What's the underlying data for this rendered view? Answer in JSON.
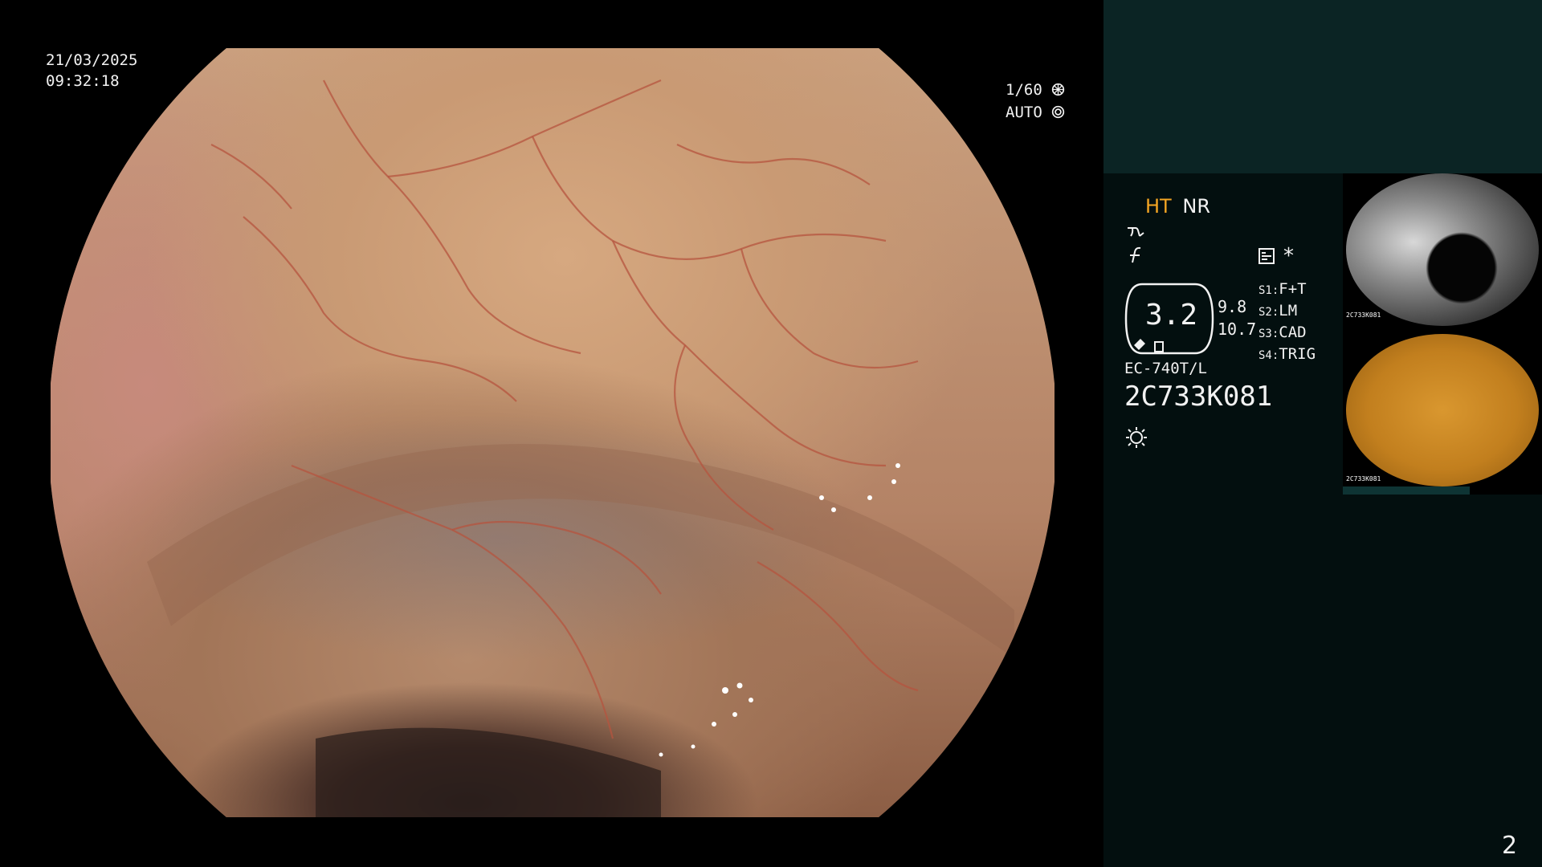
{
  "overlay": {
    "date": "21/03/2025",
    "time": "09:32:18",
    "shutter": "1/60",
    "exposure_mode": "AUTO",
    "shutter_icon": "aperture-icon",
    "auto_icon": "target-icon"
  },
  "panel": {
    "mode_ht": "HT",
    "mode_nr": "NR",
    "ht_color": "#f5a623",
    "icons": [
      "wave-enhance-icon",
      "f-curve-icon",
      "settings-box-icon",
      "asterisk-icon",
      "light-bulb-icon"
    ],
    "asterisk": "*",
    "zoom_value": "3.2",
    "zoom_right_top": "9.8",
    "zoom_right_bottom": "10.7",
    "switches": [
      {
        "key": "S1:",
        "value": "F+T"
      },
      {
        "key": "S2:",
        "value": "LM"
      },
      {
        "key": "S3:",
        "value": "CAD"
      },
      {
        "key": "S4:",
        "value": "TRIG"
      }
    ],
    "scope_model": "EC-740T/L",
    "scope_serial": "2C733K081",
    "page_number": "2"
  },
  "thumbnails": [
    {
      "name": "thumbnail-1",
      "serial": "2C733K081"
    },
    {
      "name": "thumbnail-2",
      "serial": "2C733K081"
    }
  ]
}
